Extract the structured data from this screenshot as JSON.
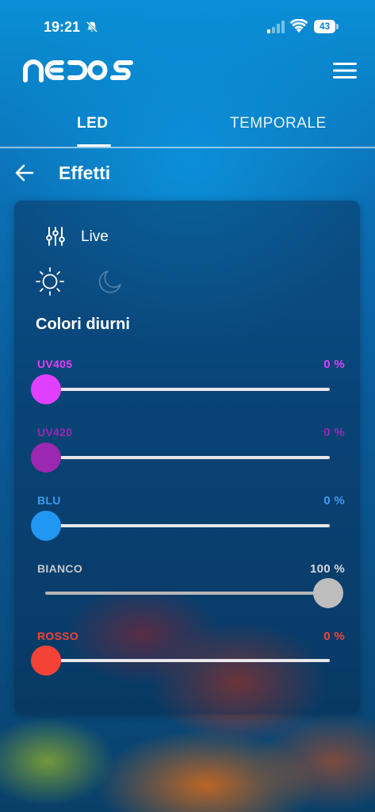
{
  "status": {
    "time": "19:21",
    "battery": "43"
  },
  "header": {
    "logo_icon": "nedos-logo",
    "menu_icon": "hamburger-menu-icon"
  },
  "tabs": [
    {
      "label": "LED",
      "active": true
    },
    {
      "label": "TEMPORALE",
      "active": false
    }
  ],
  "page": {
    "title": "Effetti",
    "back_icon": "arrow-left-icon"
  },
  "mode": {
    "label": "Live",
    "icon": "sliders-icon",
    "day_icon": "sun-icon",
    "night_icon": "moon-icon",
    "selected": "day"
  },
  "section": {
    "title": "Colori diurni"
  },
  "channels": [
    {
      "label": "UV405",
      "value": "0 %",
      "level": 0,
      "color": "#e040fb"
    },
    {
      "label": "UV420",
      "value": "0 %",
      "level": 0,
      "color": "#9c27b0"
    },
    {
      "label": "BLU",
      "value": "0 %",
      "level": 0,
      "color": "#2196f3"
    },
    {
      "label": "BIANCO",
      "value": "100 %",
      "level": 100,
      "color": "#bdbdbd"
    },
    {
      "label": "ROSSO",
      "value": "0 %",
      "level": 0,
      "color": "#f44336"
    }
  ]
}
